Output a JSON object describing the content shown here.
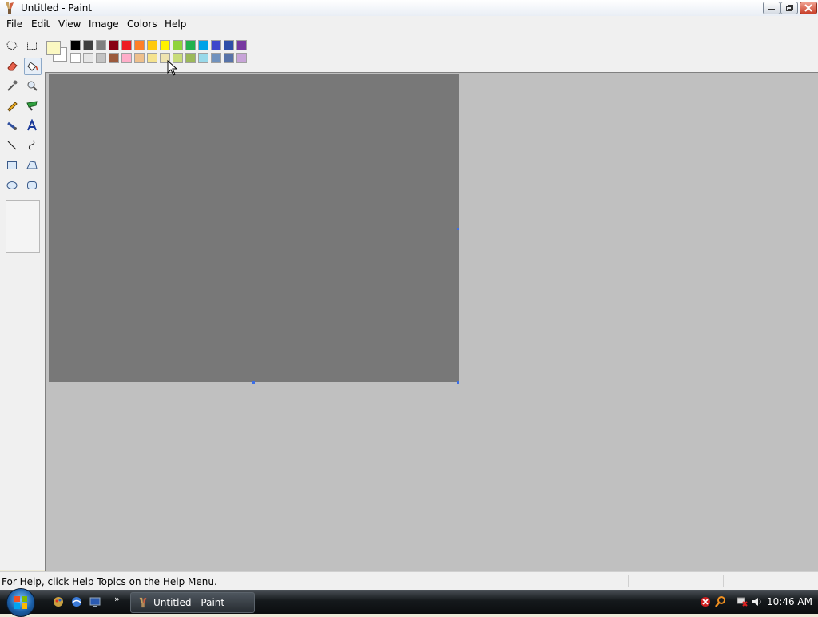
{
  "window": {
    "title": "Untitled - Paint",
    "buttons": [
      "minimize",
      "maximize",
      "close"
    ]
  },
  "menu": {
    "items": [
      "File",
      "Edit",
      "View",
      "Image",
      "Colors",
      "Help"
    ]
  },
  "toolbox": {
    "tools": [
      {
        "name": "free-form-select-icon"
      },
      {
        "name": "rect-select-icon"
      },
      {
        "name": "eraser-icon"
      },
      {
        "name": "fill-with-color-icon",
        "selected": true
      },
      {
        "name": "pick-color-icon"
      },
      {
        "name": "magnifier-icon"
      },
      {
        "name": "pencil-icon"
      },
      {
        "name": "brush-icon"
      },
      {
        "name": "airbrush-icon"
      },
      {
        "name": "text-icon"
      },
      {
        "name": "line-icon"
      },
      {
        "name": "curve-icon"
      },
      {
        "name": "rectangle-icon"
      },
      {
        "name": "polygon-icon"
      },
      {
        "name": "ellipse-icon"
      },
      {
        "name": "rounded-rectangle-icon"
      }
    ]
  },
  "colors": {
    "foreground": "#fbf8c2",
    "background": "#ffffff",
    "palette_top": [
      "#000000",
      "#3f3f3f",
      "#7f7f7f",
      "#880015",
      "#ed1c24",
      "#ff7f27",
      "#ffc90e",
      "#fff200",
      "#8fd33b",
      "#22b14c",
      "#00a2e8",
      "#3f48cc",
      "#2e4ea8",
      "#7739a0"
    ],
    "palette_bottom": [
      "#ffffff",
      "#e6e6e6",
      "#c3c3c3",
      "#9c5a3c",
      "#ffaec9",
      "#efc08c",
      "#f5e38f",
      "#efe4b0",
      "#c8dc7a",
      "#9cb95a",
      "#99d9ea",
      "#7092be",
      "#5873a8",
      "#c8a4d8"
    ]
  },
  "canvas": {
    "fill_color": "#787878",
    "workspace_color": "#c0c0c0"
  },
  "status": {
    "help_text": "For Help, click Help Topics on the Help Menu."
  },
  "taskbar": {
    "paint_button_label": "Untitled - Paint",
    "clock": "10:46 AM"
  }
}
